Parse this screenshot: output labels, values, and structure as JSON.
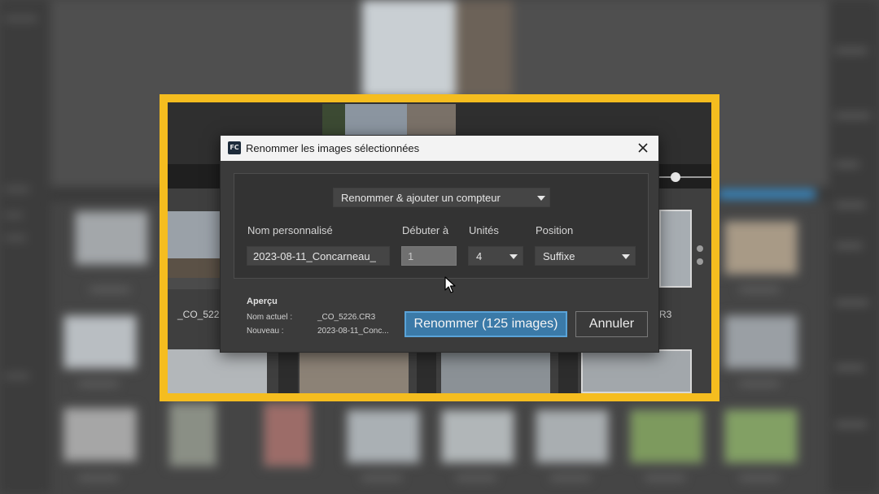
{
  "dialog": {
    "title": "Renommer les images sélectionnées",
    "app_icon_text": "FC",
    "mode": {
      "value": "Renommer & ajouter un compteur"
    },
    "fields": {
      "custom_name": {
        "label": "Nom personnalisé",
        "value": "2023-08-11_Concarneau_"
      },
      "start_at": {
        "label": "Débuter à",
        "value": "1"
      },
      "units": {
        "label": "Unités",
        "value": "4"
      },
      "position": {
        "label": "Position",
        "value": "Suffixe"
      }
    },
    "preview": {
      "title": "Aperçu",
      "current_label": "Nom actuel :",
      "current_value": "_CO_5226.CR3",
      "new_label": "Nouveau :",
      "new_value": "2023-08-11_Conc..."
    },
    "buttons": {
      "rename": "Renommer (125 images)",
      "cancel": "Annuler"
    }
  },
  "background": {
    "thumb_labels": [
      "_CO_522",
      "R3"
    ]
  },
  "colors": {
    "highlight_frame": "#f5bd1f",
    "primary_button": "#3b7aa8",
    "dialog_bg": "#3b3b3b"
  }
}
